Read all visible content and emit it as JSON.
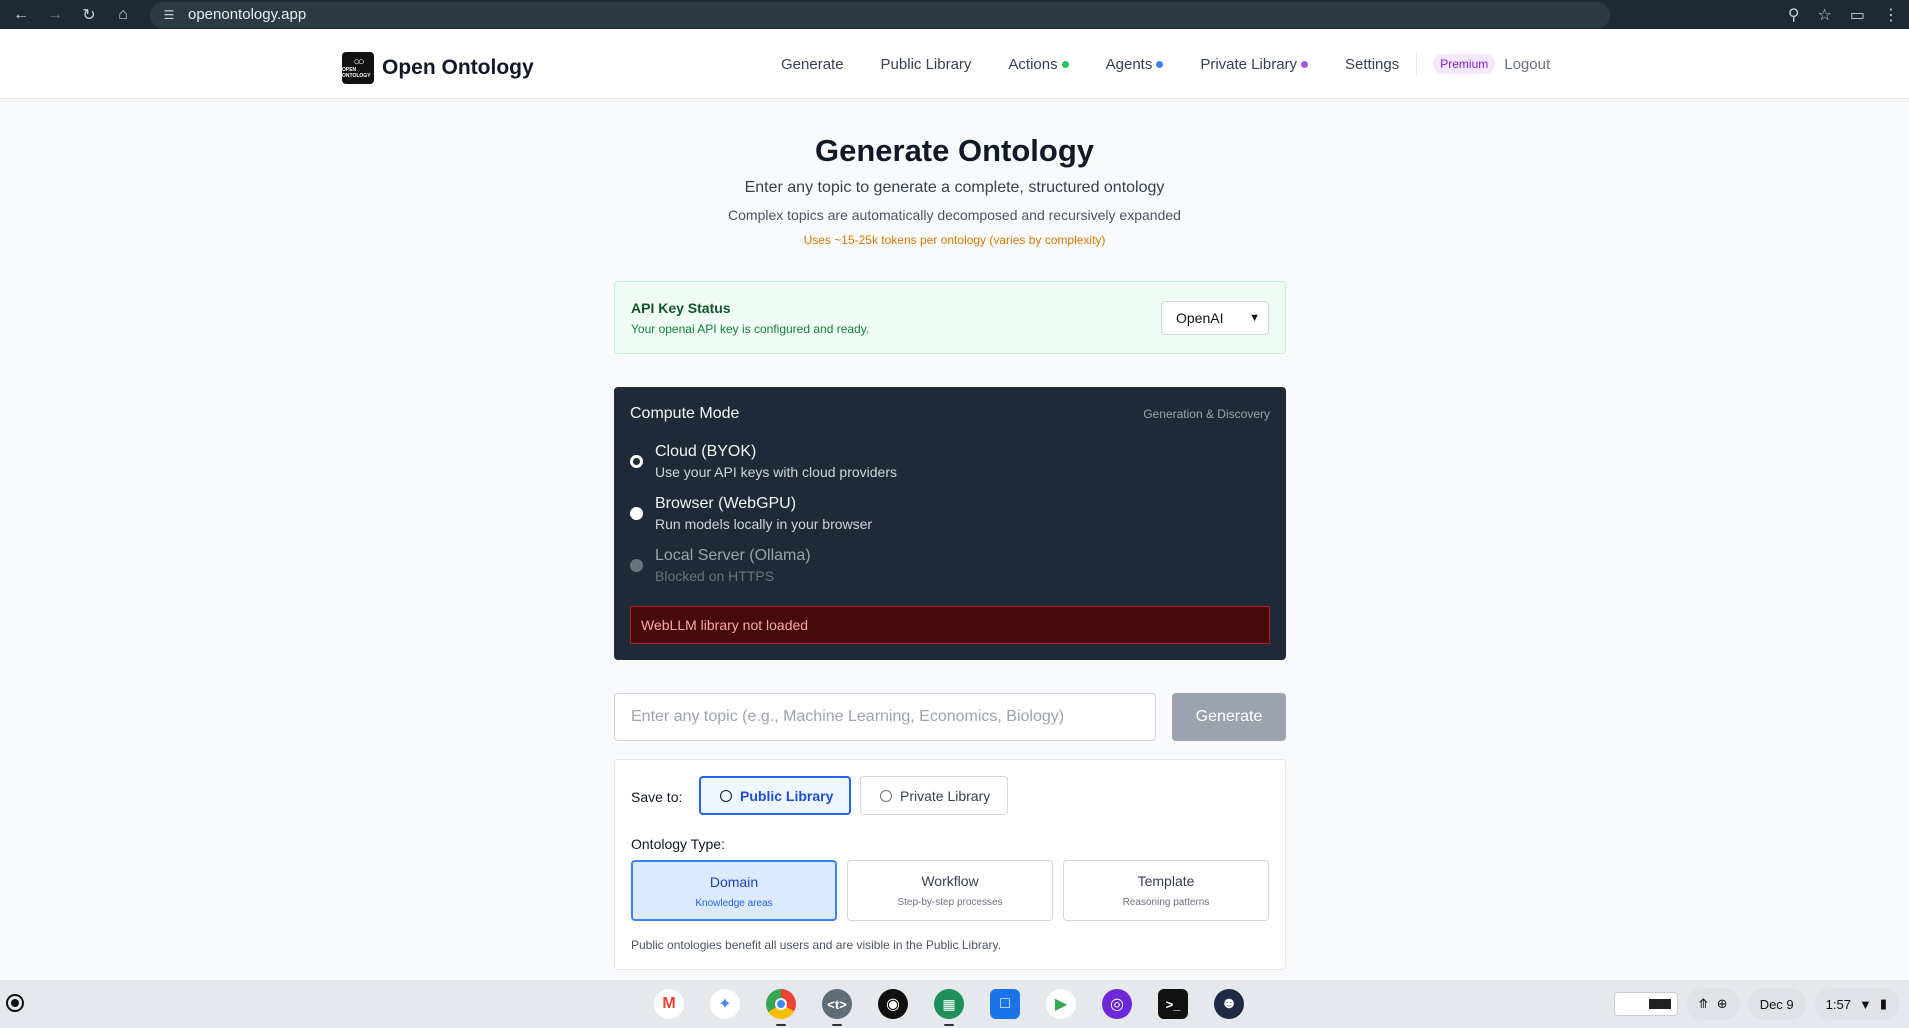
{
  "browser": {
    "url": "openontology.app"
  },
  "header": {
    "brand_name": "Open Ontology",
    "logo_text": "OPEN ONTOLOGY",
    "nav": [
      {
        "label": "Generate"
      },
      {
        "label": "Public Library"
      },
      {
        "label": "Actions",
        "dot_color": "#22c55e"
      },
      {
        "label": "Agents",
        "dot_color": "#3b82f6"
      },
      {
        "label": "Private Library",
        "dot_color": "#a855f7"
      },
      {
        "label": "Settings"
      }
    ],
    "premium_badge": "Premium",
    "logout": "Logout"
  },
  "main": {
    "title": "Generate Ontology",
    "subtitle": "Enter any topic to generate a complete, structured ontology",
    "subtitle2": "Complex topics are automatically decomposed and recursively expanded",
    "token_note": "Uses ~15-25k tokens per ontology (varies by complexity)"
  },
  "api_status": {
    "title": "API Key Status",
    "message": "Your openai API key is configured and ready.",
    "provider": "OpenAI"
  },
  "compute": {
    "title": "Compute Mode",
    "tag": "Generation & Discovery",
    "options": [
      {
        "label": "Cloud (BYOK)",
        "desc": "Use your API keys with cloud providers",
        "checked": true
      },
      {
        "label": "Browser (WebGPU)",
        "desc": "Run models locally in your browser",
        "checked": false
      },
      {
        "label": "Local Server (Ollama)",
        "desc": "Blocked on HTTPS",
        "disabled": true
      }
    ],
    "error": "WebLLM library not loaded"
  },
  "topic": {
    "placeholder": "Enter any topic (e.g., Machine Learning, Economics, Biology)",
    "value": "",
    "button": "Generate"
  },
  "save": {
    "label": "Save to:",
    "public": "Public Library",
    "private": "Private Library",
    "selected": "Public Library"
  },
  "ontology_type": {
    "label": "Ontology Type:",
    "types": [
      {
        "name": "Domain",
        "desc": "Knowledge areas"
      },
      {
        "name": "Workflow",
        "desc": "Step-by-step processes"
      },
      {
        "name": "Template",
        "desc": "Reasoning patterns"
      }
    ],
    "selected": "Domain",
    "note": "Public ontologies benefit all users and are visible in the Public Library."
  },
  "shelf": {
    "apps": [
      {
        "icon": "gmail-icon",
        "color": "#ffffff"
      },
      {
        "icon": "gemini-icon",
        "color": "#ffffff"
      },
      {
        "icon": "chrome-icon",
        "color": "#ffffff"
      },
      {
        "icon": "terminal-t-icon",
        "color": "#5f6b75"
      },
      {
        "icon": "podcast-icon",
        "color": "#111111"
      },
      {
        "icon": "apps-grid-icon",
        "color": "#1e8e5a"
      },
      {
        "icon": "files-icon",
        "color": "#1a73e8"
      },
      {
        "icon": "play-store-icon",
        "color": "#ffffff"
      },
      {
        "icon": "spiral-icon",
        "color": "#6d28d9"
      },
      {
        "icon": "terminal-icon",
        "color": "#111111"
      },
      {
        "icon": "cat-icon",
        "color": "#1f2a44"
      }
    ],
    "date": "Dec 9",
    "time": "1:57"
  }
}
